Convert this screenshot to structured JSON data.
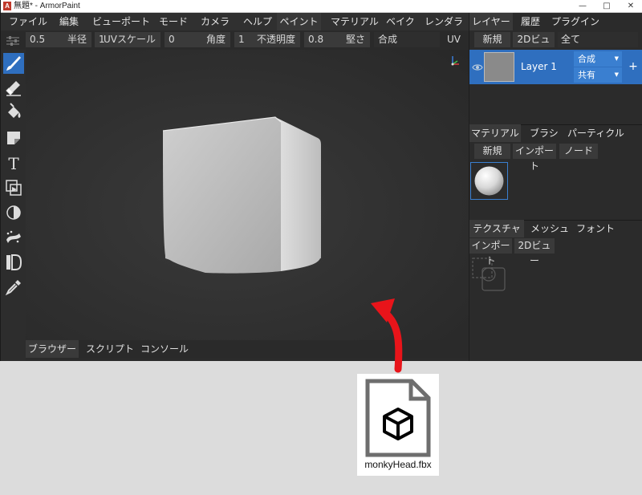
{
  "window": {
    "title": "無題* - ArmorPaint",
    "app_icon_letter": "A"
  },
  "menu": {
    "items": [
      "ファイル",
      "編集",
      "ビューポート",
      "モード",
      "カメラ",
      "ヘルプ",
      "ペイント",
      "マテリアル",
      "ベイク",
      "レンダラー"
    ],
    "active": "ペイント"
  },
  "toolbar": {
    "radius_value": "0.5",
    "radius_label": "半径",
    "uv_scale_value": "1",
    "uv_scale_label": "UVスケール",
    "angle_value": "0",
    "angle_label": "角度",
    "opacity_value": "1",
    "opacity_label": "不透明度",
    "hardness_value": "0.8",
    "hardness_label": "堅さ",
    "blend_label": "合成",
    "uv_map_label": "UVマ"
  },
  "left_tools": [
    "brush-icon",
    "eraser-icon",
    "fill-bucket-icon",
    "decal-icon",
    "text-icon",
    "clone-icon",
    "blur-icon",
    "particle-icon",
    "bake-icon",
    "color-picker-icon"
  ],
  "bottom_tabs": [
    "ブラウザー",
    "スクリプト",
    "コンソール"
  ],
  "layers_panel": {
    "tabs": [
      "レイヤー",
      "履歴",
      "プラグイン"
    ],
    "buttons": [
      "新規",
      "2Dビュー",
      "全て"
    ],
    "layer_name": "Layer 1",
    "blend_mode": "合成",
    "share_mode": "共有",
    "add_symbol": "+"
  },
  "material_panel": {
    "tabs": [
      "マテリアル",
      "ブラシ",
      "パーティクル"
    ],
    "buttons": [
      "新規",
      "インポート",
      "ノード"
    ]
  },
  "texture_panel": {
    "tabs": [
      "テクスチャ",
      "メッシュ",
      "フォント"
    ],
    "buttons": [
      "インポート",
      "2Dビュー"
    ]
  },
  "file": {
    "name": "monkyHead.fbx"
  },
  "colors": {
    "accent": "#2f6fbf",
    "arrow": "#e8141a"
  }
}
